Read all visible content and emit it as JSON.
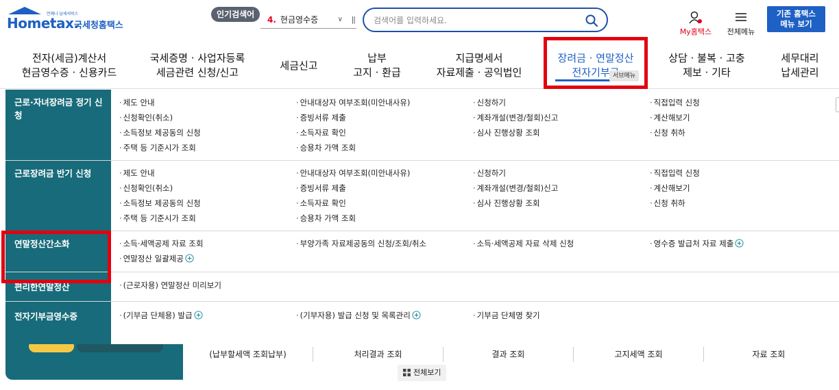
{
  "header": {
    "logo_tagline": "언제나 납세서비스",
    "logo_brand": "Hometax.",
    "logo_korean": "국세청홈택스",
    "popular_badge": "인기검색어",
    "popular_keyword_number": "4.",
    "popular_keyword_text": "현금영수증",
    "search_placeholder": "검색어를 입력하세요.",
    "my_hometax_label": "My홈택스",
    "all_menu_label": "전체메뉴",
    "old_menu_button": "기존 홈택스\n메뉴 보기"
  },
  "gnb": [
    {
      "label": "전자(세금)계산서\n현금영수증 · 신용카드"
    },
    {
      "label": "국세증명 · 사업자등록\n세금관련 신청/신고"
    },
    {
      "label": "세금신고"
    },
    {
      "label": "납부\n고지 · 환급"
    },
    {
      "label": "지급명세서\n자료제출 · 공익법인"
    },
    {
      "label": "장려금 · 연말정산\n전자기부금"
    },
    {
      "label": "상담 · 불복 · 고충\n제보 · 기타"
    },
    {
      "label": "세무대리\n납세관리"
    }
  ],
  "submenu_tag": "서브메뉴",
  "mega_menu": [
    {
      "title": "근로·자녀장려금 정기 신청",
      "links": [
        "제도 안내",
        "안내대상자 여부조회(미안내사유)",
        "신청하기",
        "직접입력 신청",
        "신청확인(취소)",
        "증빙서류 제출",
        "계좌개설(변경/철회)신고",
        "계산해보기",
        "소득정보 제공동의 신청",
        "소득자료 확인",
        "심사 진행상황 조회",
        "신청 취하",
        "주택 등 기준시가 조회",
        "승용차 가액 조회"
      ]
    },
    {
      "title": "근로장려금 반기 신청",
      "links": [
        "제도 안내",
        "안내대상자 여부조회(미안내사유)",
        "신청하기",
        "직접입력 신청",
        "신청확인(취소)",
        "증빙서류 제출",
        "계좌개설(변경/철회)신고",
        "계산해보기",
        "소득정보 제공동의 신청",
        "소득자료 확인",
        "심사 진행상황 조회",
        "신청 취하",
        "주택 등 기준시가 조회",
        "승용차 가액 조회"
      ]
    },
    {
      "title": "연말정산간소화",
      "links": [
        "소득·세액공제 자료 조회",
        "부양가족 자료제공동의 신청/조회/취소",
        "소득·세액공제 자료 삭제 신청",
        "영수증 발급처 자료 제출",
        "연말정산 일괄제공"
      ]
    },
    {
      "title": "편리한연말정산",
      "links": [
        "(근로자용) 연말정산 미리보기"
      ]
    },
    {
      "title": "전자기부금영수증",
      "links": [
        "(기부금 단체용) 발급",
        "(기부자용) 발급 신청 및 목록관리",
        "기부금 단체명 찾기"
      ]
    }
  ],
  "bottom": {
    "tabs": [
      "(납부할세액 조회납부)",
      "처리결과 조회",
      "결과 조회",
      "고지세액 조회",
      "자료 조회"
    ],
    "view_all": "전체보기"
  },
  "colors": {
    "brand_blue": "#1e60c4",
    "teal": "#186b7a",
    "highlight_red": "#e3000f"
  }
}
